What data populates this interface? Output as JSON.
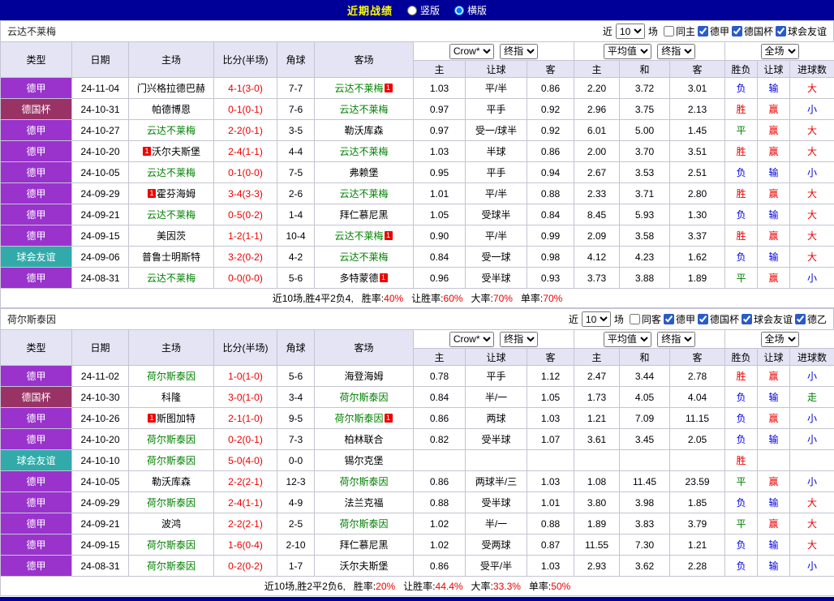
{
  "topbar": {
    "title": "近期战绩",
    "options": [
      {
        "label": "竖版",
        "selected": false
      },
      {
        "label": "横版",
        "selected": true
      }
    ]
  },
  "colors": {
    "topbar_bg": "#000099",
    "title": "#FFFF00",
    "header_bg": "#E4E4F4",
    "league": {
      "德甲": "#9933CC",
      "德国杯": "#993366",
      "球会友谊": "#33AAAA",
      "德乙": "#3366CC"
    },
    "team": "#008000",
    "score": "#EE0000",
    "result": {
      "red": "#EE0000",
      "green": "#008000",
      "blue": "#0000DD"
    },
    "badge_bg": "#EE0000"
  },
  "badge_char": "1",
  "table_header": {
    "cols": [
      "类型",
      "日期",
      "主场",
      "比分(半场)",
      "角球",
      "客场"
    ],
    "odds_groups": [
      {
        "selects": [
          "Crow*",
          "终指"
        ],
        "cols": [
          "主",
          "让球",
          "客"
        ]
      },
      {
        "selects": [
          "平均值",
          "终指"
        ],
        "cols": [
          "主",
          "和",
          "客"
        ]
      },
      {
        "selects": [
          "全场"
        ],
        "cols": [
          "胜负",
          "让球",
          "进球数"
        ]
      }
    ]
  },
  "sections": [
    {
      "team": "云达不莱梅",
      "controls": {
        "near_label": "近",
        "count": "10",
        "games_label": "场",
        "checkboxes": [
          {
            "label": "同主",
            "checked": false
          },
          {
            "label": "德甲",
            "checked": true
          },
          {
            "label": "德国杯",
            "checked": true
          },
          {
            "label": "球会友谊",
            "checked": true
          }
        ]
      },
      "rows": [
        {
          "league": "德甲",
          "date": "24-11-04",
          "home": {
            "name": "门兴格拉德巴赫"
          },
          "score": "4-1(3-0)",
          "corners": "7-7",
          "away": {
            "name": "云达不莱梅",
            "tracked": true,
            "badge": "after"
          },
          "odds": [
            "1.03",
            "平/半",
            "0.86",
            "2.20",
            "3.72",
            "3.01"
          ],
          "results": [
            [
              "负",
              "blue"
            ],
            [
              "输",
              "blue"
            ],
            [
              "大",
              "red"
            ]
          ]
        },
        {
          "league": "德国杯",
          "date": "24-10-31",
          "home": {
            "name": "帕德博恩"
          },
          "score": "0-1(0-1)",
          "corners": "7-6",
          "away": {
            "name": "云达不莱梅",
            "tracked": true
          },
          "odds": [
            "0.97",
            "平手",
            "0.92",
            "2.96",
            "3.75",
            "2.13"
          ],
          "results": [
            [
              "胜",
              "red"
            ],
            [
              "赢",
              "red"
            ],
            [
              "小",
              "blue"
            ]
          ]
        },
        {
          "league": "德甲",
          "date": "24-10-27",
          "home": {
            "name": "云达不莱梅",
            "tracked": true
          },
          "score": "2-2(0-1)",
          "corners": "3-5",
          "away": {
            "name": "勒沃库森"
          },
          "odds": [
            "0.97",
            "受一/球半",
            "0.92",
            "6.01",
            "5.00",
            "1.45"
          ],
          "results": [
            [
              "平",
              "green"
            ],
            [
              "赢",
              "red"
            ],
            [
              "大",
              "red"
            ]
          ]
        },
        {
          "league": "德甲",
          "date": "24-10-20",
          "home": {
            "name": "沃尔夫斯堡",
            "badge": "before"
          },
          "score": "2-4(1-1)",
          "corners": "4-4",
          "away": {
            "name": "云达不莱梅",
            "tracked": true
          },
          "odds": [
            "1.03",
            "半球",
            "0.86",
            "2.00",
            "3.70",
            "3.51"
          ],
          "results": [
            [
              "胜",
              "red"
            ],
            [
              "赢",
              "red"
            ],
            [
              "大",
              "red"
            ]
          ]
        },
        {
          "league": "德甲",
          "date": "24-10-05",
          "home": {
            "name": "云达不莱梅",
            "tracked": true
          },
          "score": "0-1(0-0)",
          "corners": "7-5",
          "away": {
            "name": "弗赖堡"
          },
          "odds": [
            "0.95",
            "平手",
            "0.94",
            "2.67",
            "3.53",
            "2.51"
          ],
          "results": [
            [
              "负",
              "blue"
            ],
            [
              "输",
              "blue"
            ],
            [
              "小",
              "blue"
            ]
          ]
        },
        {
          "league": "德甲",
          "date": "24-09-29",
          "home": {
            "name": "霍芬海姆",
            "badge": "before"
          },
          "score": "3-4(3-3)",
          "corners": "2-6",
          "away": {
            "name": "云达不莱梅",
            "tracked": true
          },
          "odds": [
            "1.01",
            "平/半",
            "0.88",
            "2.33",
            "3.71",
            "2.80"
          ],
          "results": [
            [
              "胜",
              "red"
            ],
            [
              "赢",
              "red"
            ],
            [
              "大",
              "red"
            ]
          ]
        },
        {
          "league": "德甲",
          "date": "24-09-21",
          "home": {
            "name": "云达不莱梅",
            "tracked": true
          },
          "score": "0-5(0-2)",
          "corners": "1-4",
          "away": {
            "name": "拜仁慕尼黑"
          },
          "odds": [
            "1.05",
            "受球半",
            "0.84",
            "8.45",
            "5.93",
            "1.30"
          ],
          "results": [
            [
              "负",
              "blue"
            ],
            [
              "输",
              "blue"
            ],
            [
              "大",
              "red"
            ]
          ]
        },
        {
          "league": "德甲",
          "date": "24-09-15",
          "home": {
            "name": "美因茨"
          },
          "score": "1-2(1-1)",
          "corners": "10-4",
          "away": {
            "name": "云达不莱梅",
            "tracked": true,
            "badge": "after"
          },
          "odds": [
            "0.90",
            "平/半",
            "0.99",
            "2.09",
            "3.58",
            "3.37"
          ],
          "results": [
            [
              "胜",
              "red"
            ],
            [
              "赢",
              "red"
            ],
            [
              "大",
              "red"
            ]
          ]
        },
        {
          "league": "球会友谊",
          "date": "24-09-06",
          "home": {
            "name": "普鲁士明斯特"
          },
          "score": "3-2(0-2)",
          "corners": "4-2",
          "away": {
            "name": "云达不莱梅",
            "tracked": true
          },
          "odds": [
            "0.84",
            "受一球",
            "0.98",
            "4.12",
            "4.23",
            "1.62"
          ],
          "results": [
            [
              "负",
              "blue"
            ],
            [
              "输",
              "blue"
            ],
            [
              "大",
              "red"
            ]
          ]
        },
        {
          "league": "德甲",
          "date": "24-08-31",
          "home": {
            "name": "云达不莱梅",
            "tracked": true
          },
          "score": "0-0(0-0)",
          "corners": "5-6",
          "away": {
            "name": "多特蒙德",
            "badge": "after"
          },
          "odds": [
            "0.96",
            "受半球",
            "0.93",
            "3.73",
            "3.88",
            "1.89"
          ],
          "results": [
            [
              "平",
              "green"
            ],
            [
              "赢",
              "red"
            ],
            [
              "小",
              "blue"
            ]
          ]
        }
      ],
      "footer": {
        "prefix": "近10场,胜4平2负4,",
        "stats": [
          {
            "label": "胜率:",
            "value": "40%"
          },
          {
            "label": "让胜率:",
            "value": "60%"
          },
          {
            "label": "大率:",
            "value": "70%"
          },
          {
            "label": "单率:",
            "value": "70%"
          }
        ]
      }
    },
    {
      "team": "荷尔斯泰因",
      "controls": {
        "near_label": "近",
        "count": "10",
        "games_label": "场",
        "checkboxes": [
          {
            "label": "同客",
            "checked": false
          },
          {
            "label": "德甲",
            "checked": true
          },
          {
            "label": "德国杯",
            "checked": true
          },
          {
            "label": "球会友谊",
            "checked": true
          },
          {
            "label": "德乙",
            "checked": true
          }
        ]
      },
      "rows": [
        {
          "league": "德甲",
          "date": "24-11-02",
          "home": {
            "name": "荷尔斯泰因",
            "tracked": true
          },
          "score": "1-0(1-0)",
          "corners": "5-6",
          "away": {
            "name": "海登海姆"
          },
          "odds": [
            "0.78",
            "平手",
            "1.12",
            "2.47",
            "3.44",
            "2.78"
          ],
          "results": [
            [
              "胜",
              "red"
            ],
            [
              "赢",
              "red"
            ],
            [
              "小",
              "blue"
            ]
          ]
        },
        {
          "league": "德国杯",
          "date": "24-10-30",
          "home": {
            "name": "科隆"
          },
          "score": "3-0(1-0)",
          "corners": "3-4",
          "away": {
            "name": "荷尔斯泰因",
            "tracked": true
          },
          "odds": [
            "0.84",
            "半/一",
            "1.05",
            "1.73",
            "4.05",
            "4.04"
          ],
          "results": [
            [
              "负",
              "blue"
            ],
            [
              "输",
              "blue"
            ],
            [
              "走",
              "green"
            ]
          ]
        },
        {
          "league": "德甲",
          "date": "24-10-26",
          "home": {
            "name": "斯图加特",
            "badge": "before"
          },
          "score": "2-1(1-0)",
          "corners": "9-5",
          "away": {
            "name": "荷尔斯泰因",
            "tracked": true,
            "badge": "after"
          },
          "odds": [
            "0.86",
            "两球",
            "1.03",
            "1.21",
            "7.09",
            "11.15"
          ],
          "results": [
            [
              "负",
              "blue"
            ],
            [
              "赢",
              "red"
            ],
            [
              "小",
              "blue"
            ]
          ]
        },
        {
          "league": "德甲",
          "date": "24-10-20",
          "home": {
            "name": "荷尔斯泰因",
            "tracked": true
          },
          "score": "0-2(0-1)",
          "corners": "7-3",
          "away": {
            "name": "柏林联合"
          },
          "odds": [
            "0.82",
            "受半球",
            "1.07",
            "3.61",
            "3.45",
            "2.05"
          ],
          "results": [
            [
              "负",
              "blue"
            ],
            [
              "输",
              "blue"
            ],
            [
              "小",
              "blue"
            ]
          ]
        },
        {
          "league": "球会友谊",
          "date": "24-10-10",
          "home": {
            "name": "荷尔斯泰因",
            "tracked": true
          },
          "score": "5-0(4-0)",
          "corners": "0-0",
          "away": {
            "name": "锡尔克堡"
          },
          "odds": [
            "",
            "",
            "",
            "",
            "",
            ""
          ],
          "results": [
            [
              "胜",
              "red"
            ],
            null,
            null
          ]
        },
        {
          "league": "德甲",
          "date": "24-10-05",
          "home": {
            "name": "勒沃库森"
          },
          "score": "2-2(2-1)",
          "corners": "12-3",
          "away": {
            "name": "荷尔斯泰因",
            "tracked": true
          },
          "odds": [
            "0.86",
            "两球半/三",
            "1.03",
            "1.08",
            "11.45",
            "23.59"
          ],
          "results": [
            [
              "平",
              "green"
            ],
            [
              "赢",
              "red"
            ],
            [
              "小",
              "blue"
            ]
          ]
        },
        {
          "league": "德甲",
          "date": "24-09-29",
          "home": {
            "name": "荷尔斯泰因",
            "tracked": true
          },
          "score": "2-4(1-1)",
          "corners": "4-9",
          "away": {
            "name": "法兰克福"
          },
          "odds": [
            "0.88",
            "受半球",
            "1.01",
            "3.80",
            "3.98",
            "1.85"
          ],
          "results": [
            [
              "负",
              "blue"
            ],
            [
              "输",
              "blue"
            ],
            [
              "大",
              "red"
            ]
          ]
        },
        {
          "league": "德甲",
          "date": "24-09-21",
          "home": {
            "name": "波鸿"
          },
          "score": "2-2(2-1)",
          "corners": "2-5",
          "away": {
            "name": "荷尔斯泰因",
            "tracked": true
          },
          "odds": [
            "1.02",
            "半/一",
            "0.88",
            "1.89",
            "3.83",
            "3.79"
          ],
          "results": [
            [
              "平",
              "green"
            ],
            [
              "赢",
              "red"
            ],
            [
              "大",
              "red"
            ]
          ]
        },
        {
          "league": "德甲",
          "date": "24-09-15",
          "home": {
            "name": "荷尔斯泰因",
            "tracked": true
          },
          "score": "1-6(0-4)",
          "corners": "2-10",
          "away": {
            "name": "拜仁慕尼黑"
          },
          "odds": [
            "1.02",
            "受两球",
            "0.87",
            "11.55",
            "7.30",
            "1.21"
          ],
          "results": [
            [
              "负",
              "blue"
            ],
            [
              "输",
              "blue"
            ],
            [
              "大",
              "red"
            ]
          ]
        },
        {
          "league": "德甲",
          "date": "24-08-31",
          "home": {
            "name": "荷尔斯泰因",
            "tracked": true
          },
          "score": "0-2(0-2)",
          "corners": "1-7",
          "away": {
            "name": "沃尔夫斯堡"
          },
          "odds": [
            "0.86",
            "受平/半",
            "1.03",
            "2.93",
            "3.62",
            "2.28"
          ],
          "results": [
            [
              "负",
              "blue"
            ],
            [
              "输",
              "blue"
            ],
            [
              "小",
              "blue"
            ]
          ]
        }
      ],
      "footer": {
        "prefix": "近10场,胜2平2负6,",
        "stats": [
          {
            "label": "胜率:",
            "value": "20%"
          },
          {
            "label": "让胜率:",
            "value": "44.4%"
          },
          {
            "label": "大率:",
            "value": "33.3%"
          },
          {
            "label": "单率:",
            "value": "50%"
          }
        ]
      }
    }
  ]
}
